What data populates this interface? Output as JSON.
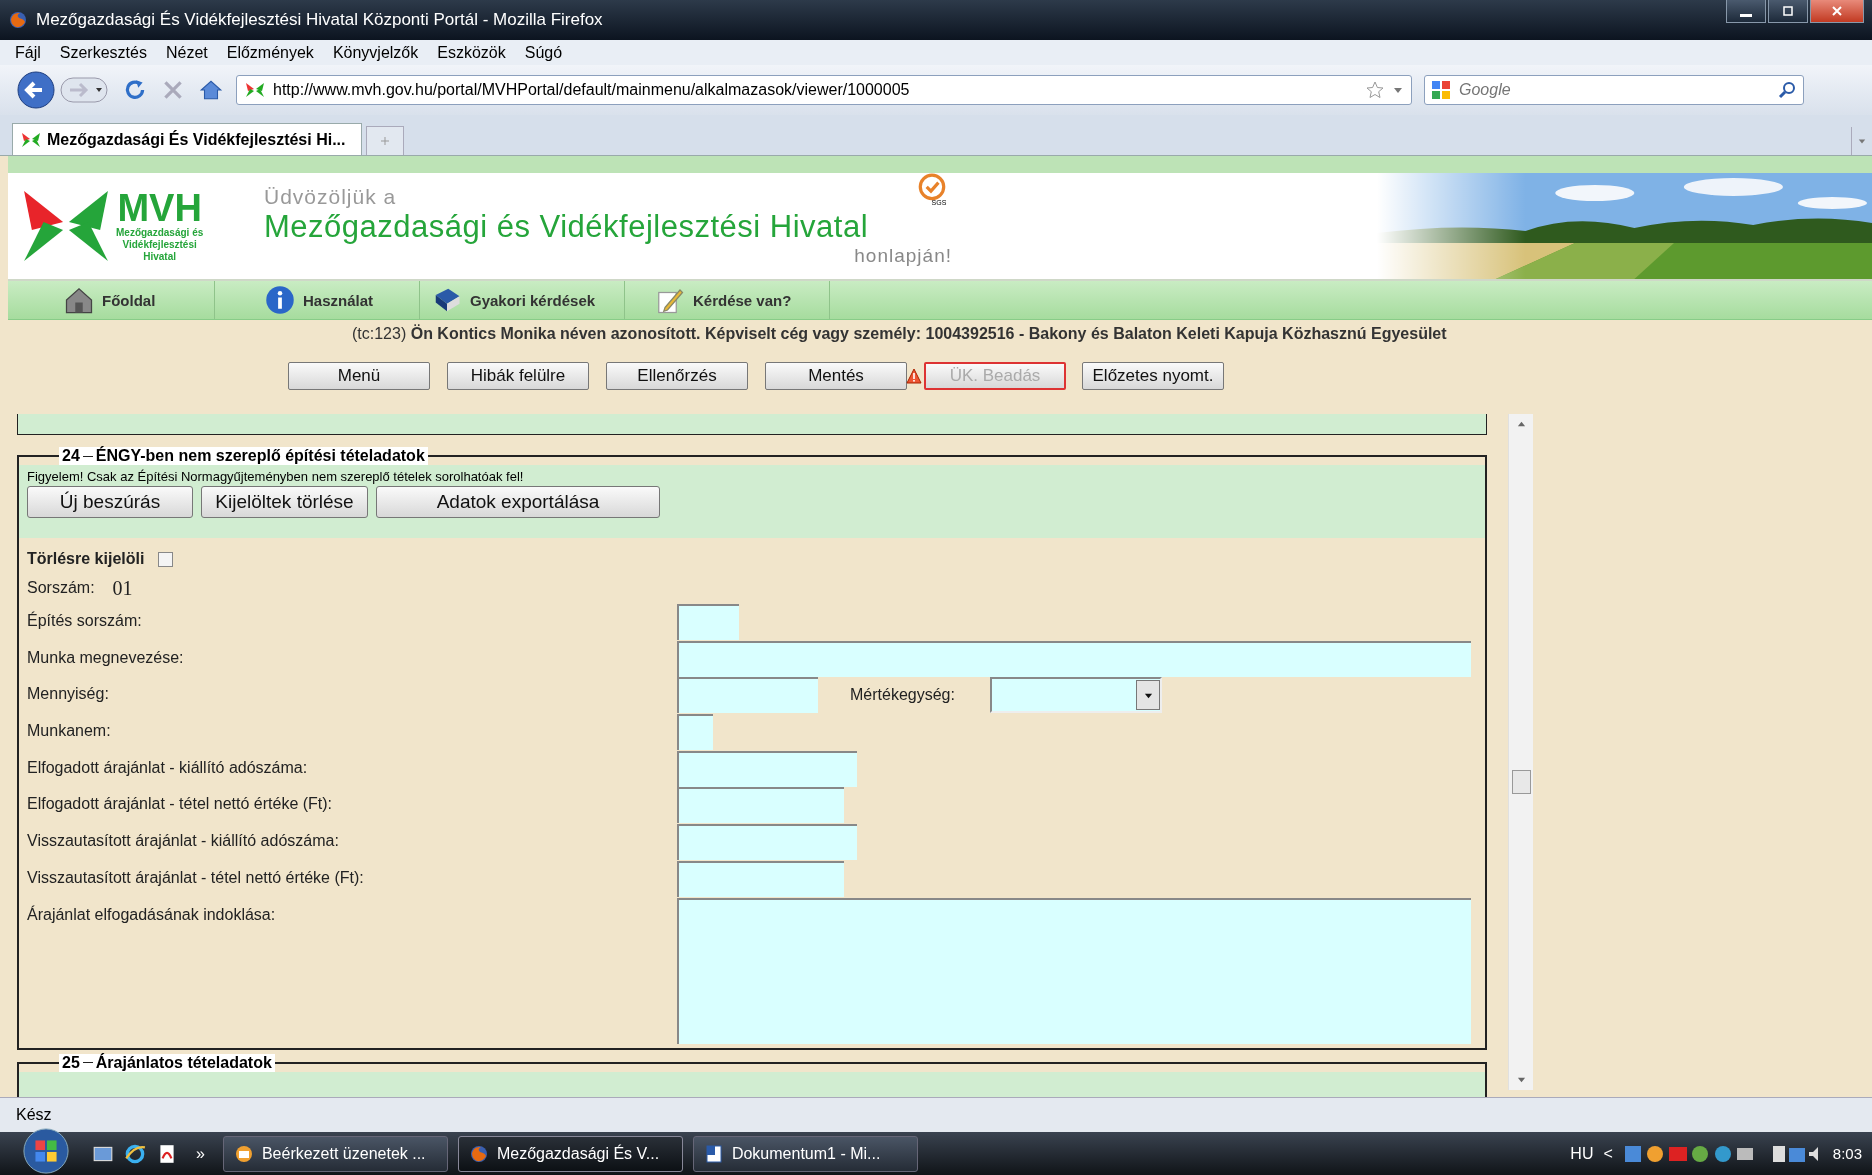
{
  "window": {
    "title": "Mezőgazdasági És Vidékfejlesztési Hivatal Központi Portál - Mozilla Firefox"
  },
  "menu": [
    "Fájl",
    "Szerkesztés",
    "Nézet",
    "Előzmények",
    "Könyvjelzők",
    "Eszközök",
    "Súgó"
  ],
  "address": {
    "url": "http://www.mvh.gov.hu/portal/MVHPortal/default/mainmenu/alkalmazasok/viewer/1000005"
  },
  "search": {
    "placeholder": "Google"
  },
  "tabs": [
    {
      "label": "Mezőgazdasági És Vidékfejlesztési Hi...",
      "selected": true
    }
  ],
  "banner": {
    "logo_text": "MVH",
    "logo_sub": [
      "Mezőgazdasági és",
      "Vidékfejlesztési",
      "Hivatal"
    ],
    "welcome": "Üdvözöljük a",
    "title": "Mezőgazdasági és Vidékfejlesztési Hivatal",
    "suffix": "honlapján!",
    "badge": "SGS",
    "picture": {
      "kind": "picture"
    }
  },
  "site_nav": [
    {
      "label": "Főoldal",
      "kind": "home"
    },
    {
      "label": "Használat",
      "kind": "info"
    },
    {
      "label": "Gyakori kérdések",
      "kind": "book"
    },
    {
      "label": "Kérdése van?",
      "kind": "pencil"
    }
  ],
  "user_info": "(tc:123) **Ön Kontics Monika néven azonosított.  Képviselt cég vagy személy: 1004392516 - Bakony és Balaton Keleti Kapuja Közhasznú Egyesület**",
  "actions": [
    {
      "label": "Menü",
      "disabled": false,
      "warning": false
    },
    {
      "label": "Hibák felülre",
      "disabled": false,
      "warning": false
    },
    {
      "label": "Ellenőrzés",
      "disabled": false,
      "warning": false
    },
    {
      "label": "Mentés",
      "disabled": false,
      "warning": true
    },
    {
      "label": "ÜK. Beadás",
      "disabled": true,
      "warning": false
    },
    {
      "label": "Előzetes nyomt.",
      "disabled": false,
      "warning": false
    }
  ],
  "section_24": {
    "number": "24",
    "title": "ÉNGY-ben nem szereplő építési tételadatok",
    "notice": "Figyelem! Csak az Építési Normagyűjteményben nem szereplő tételek sorolhatóak fel!",
    "buttons": [
      "Új beszúrás",
      "Kijelöltek törlése",
      "Adatok exportálása"
    ],
    "delete_mark": {
      "label": "Törlésre kijelöli",
      "checked": false
    },
    "serial": {
      "label": "Sorszám:",
      "value": "01"
    },
    "fields": [
      {
        "label": "Építés sorszám:",
        "kind": "input"
      },
      {
        "label": "Munka megnevezése:",
        "kind": "input"
      },
      {
        "label": "Mennyiség:",
        "kind": "input",
        "unit_label": "Mértékegység:"
      },
      {
        "label": "Munkanem:",
        "kind": "input"
      },
      {
        "label": "Elfogadott árajánlat - kiállító adószáma:",
        "kind": "input"
      },
      {
        "label": "Elfogadott árajánlat - tétel nettó értéke (Ft):",
        "kind": "input"
      },
      {
        "label": "Visszautasított árajánlat - kiállító adószáma:",
        "kind": "input"
      },
      {
        "label": "Visszautasított árajánlat - tétel nettó értéke (Ft):",
        "kind": "input"
      },
      {
        "label": "Árajánlat elfogadásának indoklása:",
        "kind": "textarea"
      }
    ]
  },
  "section_25": {
    "number": "25",
    "title": "Árajánlatos tételadatok"
  },
  "status_bar": "Kész",
  "taskbar": {
    "tasks": [
      {
        "label": "Beérkezett üzenetek ...",
        "kind": "mail",
        "selected": false
      },
      {
        "label": "Mezőgazdasági És V...",
        "kind": "browser",
        "selected": true
      },
      {
        "label": "Dokumentum1 - Mi...",
        "kind": "doc",
        "selected": false
      }
    ],
    "more": "»",
    "language": "HU",
    "tray_arrow": "<",
    "clock": "8:03"
  }
}
